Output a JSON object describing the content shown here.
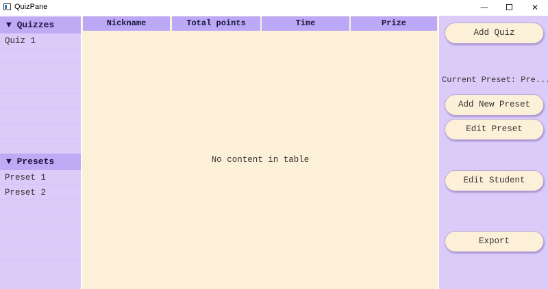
{
  "window": {
    "title": "QuizPane",
    "minimize_glyph": "—",
    "close_glyph": "✕"
  },
  "sidebar": {
    "quizzes_header": "▼ Quizzes",
    "quizzes": [
      "Quiz 1"
    ],
    "presets_header": "▼ Presets",
    "presets": [
      "Preset 1",
      "Preset 2"
    ]
  },
  "table": {
    "columns": [
      "Nickname",
      "Total points",
      "Time",
      "Prize"
    ],
    "rows": [],
    "empty_message": "No content in table"
  },
  "right_panel": {
    "add_quiz_label": "Add Quiz",
    "current_preset_text": "Current Preset: Pre...",
    "add_new_preset_label": "Add New Preset",
    "edit_preset_label": "Edit Preset",
    "edit_student_label": "Edit Student",
    "export_label": "Export"
  },
  "colors": {
    "panel": "#dccbf8",
    "header": "#bfaaf6",
    "table_bg": "#fdf0d8",
    "button_bg": "#fdf0d8"
  }
}
